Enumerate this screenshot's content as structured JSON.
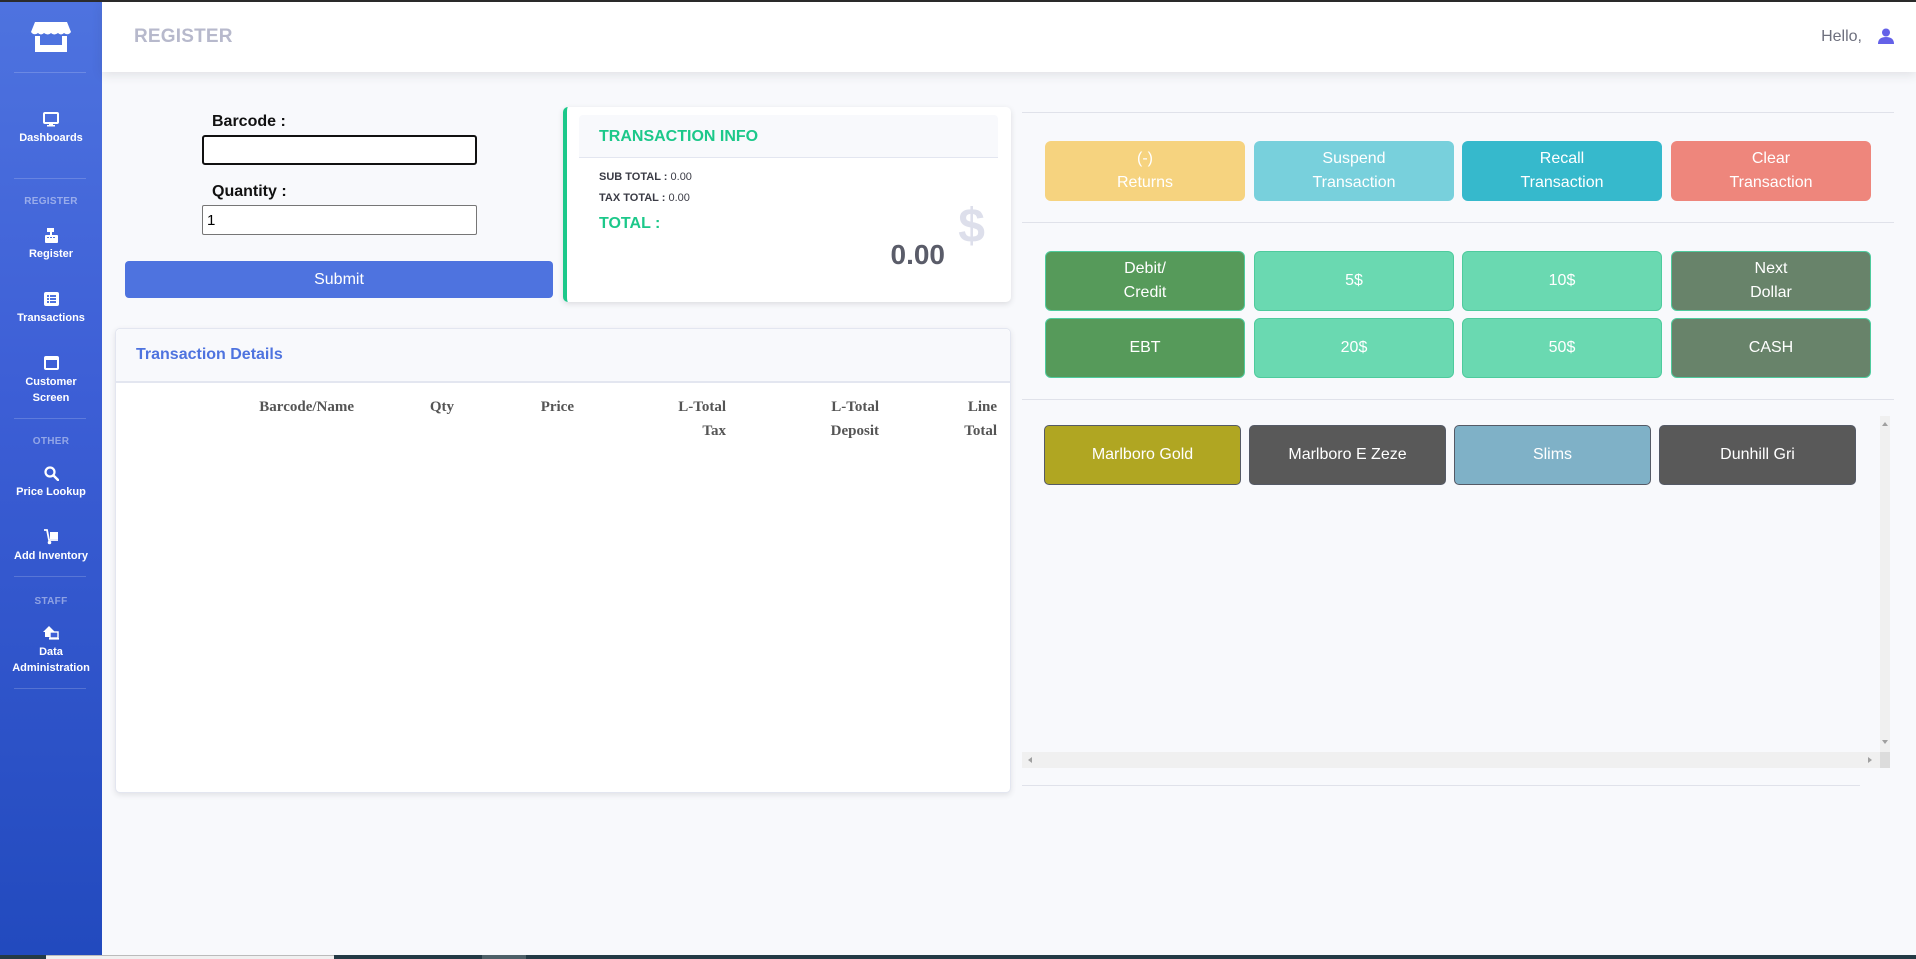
{
  "app": {
    "page_title": "REGISTER",
    "greeting": "Hello,"
  },
  "sidebar": {
    "brand_icon": "store-icon",
    "items": [
      {
        "id": "dashboards",
        "label": "Dashboards",
        "icon": "desktop-icon"
      },
      {
        "id": "register",
        "label": "Register",
        "icon": "cash-register-icon"
      },
      {
        "id": "transactions",
        "label": "Transactions",
        "icon": "list-alt-icon"
      },
      {
        "id": "customer-screen",
        "label_line1": "Customer",
        "label_line2": "Screen",
        "icon": "window-icon"
      },
      {
        "id": "price-lookup",
        "label": "Price Lookup",
        "icon": "search-icon"
      },
      {
        "id": "add-inventory",
        "label": "Add Inventory",
        "icon": "dolly-icon"
      },
      {
        "id": "data-administration",
        "label_line1": "Data",
        "label_line2": "Administration",
        "icon": "house-laptop-icon"
      }
    ],
    "headings": {
      "register": "REGISTER",
      "other": "OTHER",
      "staff": "STAFF"
    }
  },
  "form": {
    "barcode_label": "Barcode :",
    "barcode_value": "",
    "quantity_label": "Quantity :",
    "quantity_value": "1",
    "submit_label": "Submit"
  },
  "transaction_info": {
    "title": "TRANSACTION INFO",
    "sub_total_label": "SUB TOTAL :",
    "sub_total_value": "0.00",
    "tax_total_label": "TAX TOTAL :",
    "tax_total_value": "0.00",
    "total_label": "TOTAL :",
    "total_value": "0.00",
    "icon": "$"
  },
  "transaction_details": {
    "title": "Transaction Details",
    "columns": [
      {
        "line1": "Barcode/Name",
        "line2": ""
      },
      {
        "line1": "Qty",
        "line2": ""
      },
      {
        "line1": "Price",
        "line2": ""
      },
      {
        "line1": "L-Total",
        "line2": "Tax"
      },
      {
        "line1": "L-Total",
        "line2": "Deposit"
      },
      {
        "line1": "Line",
        "line2": "Total"
      }
    ],
    "rows": []
  },
  "actions": [
    {
      "line1": "(-)",
      "line2": "Returns",
      "color": "#f6d37f"
    },
    {
      "line1": "Suspend",
      "line2": "Transaction",
      "color": "#78d0dc"
    },
    {
      "line1": "Recall",
      "line2": "Transaction",
      "color": "#36b9cc"
    },
    {
      "line1": "Clear",
      "line2": "Transaction",
      "color": "#ee867c"
    }
  ],
  "payments": [
    {
      "line1": "Debit/",
      "line2": "Credit",
      "color": "#569a5a"
    },
    {
      "line1": "5$",
      "line2": "",
      "color": "#6ad9b1"
    },
    {
      "line1": "10$",
      "line2": "",
      "color": "#6ad9b1"
    },
    {
      "line1": "Next",
      "line2": "Dollar",
      "color": "#68836a"
    },
    {
      "line1": "EBT",
      "line2": "",
      "color": "#569a5a"
    },
    {
      "line1": "20$",
      "line2": "",
      "color": "#6ad9b1"
    },
    {
      "line1": "50$",
      "line2": "",
      "color": "#6ad9b1"
    },
    {
      "line1": "CASH",
      "line2": "",
      "color": "#68836a"
    }
  ],
  "products": [
    {
      "label": "Marlboro Gold",
      "color": "#b0a622"
    },
    {
      "label": "Marlboro E Zeze",
      "color": "#595959"
    },
    {
      "label": "Slims",
      "color": "#7fb1c7"
    },
    {
      "label": "Dunhill Gri",
      "color": "#595959"
    }
  ]
}
